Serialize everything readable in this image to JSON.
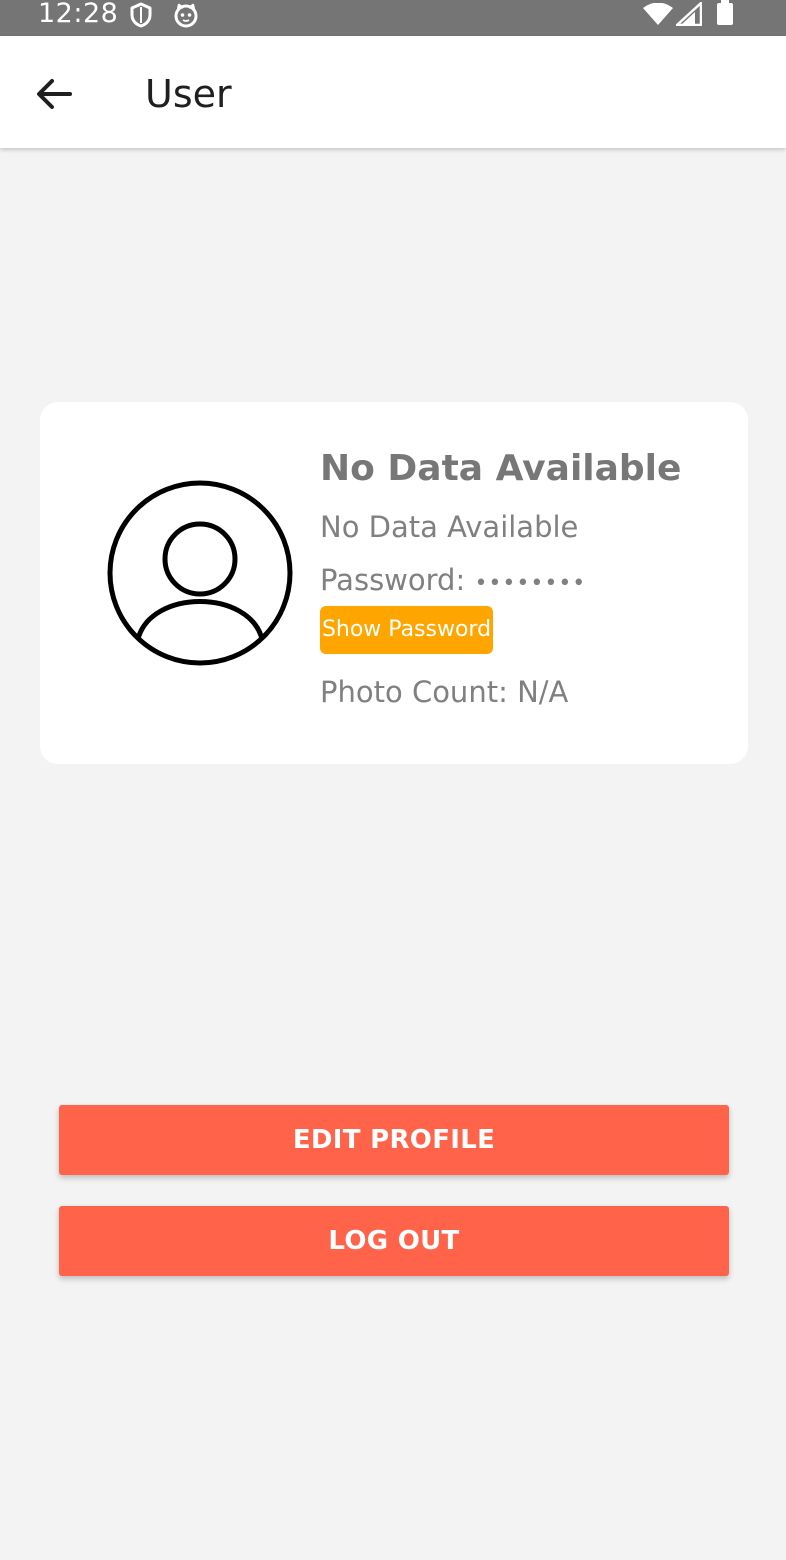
{
  "status_bar": {
    "time": "12:28",
    "icons": [
      "shield-icon",
      "cat-icon",
      "wifi-icon",
      "signal-icon",
      "battery-icon"
    ]
  },
  "app_bar": {
    "back_icon": "arrow-left-icon",
    "title": "User"
  },
  "profile": {
    "avatar_icon": "user-circle-icon",
    "name": "No Data Available",
    "email": "No Data Available",
    "password_label": "Password:",
    "password_value": "••••••••",
    "show_password_label": "Show Password",
    "photo_count_label": "Photo Count:",
    "photo_count_value": "N/A"
  },
  "actions": {
    "edit_profile_label": "EDIT PROFILE",
    "log_out_label": "LOG OUT"
  },
  "colors": {
    "status_bar_bg": "#757575",
    "background": "#f3f3f3",
    "accent_orange": "#ffa500",
    "button_red": "#ff644b",
    "muted_text": "#808080"
  }
}
